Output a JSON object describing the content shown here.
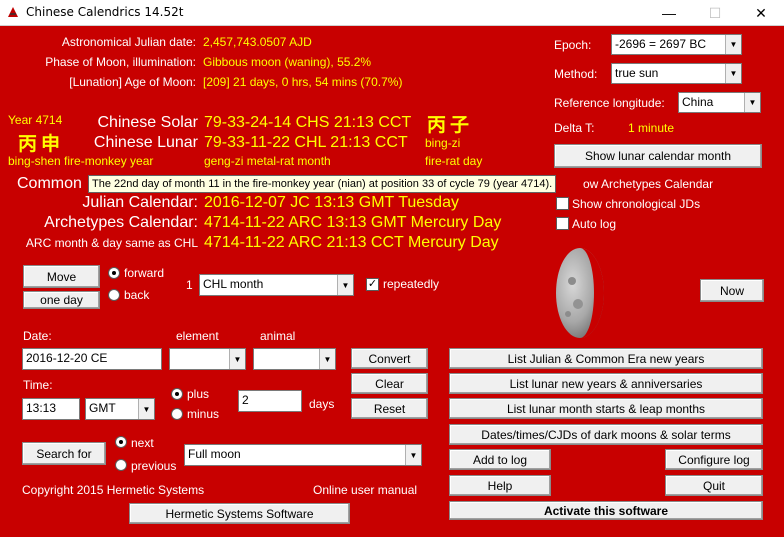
{
  "window": {
    "title": "Chinese Calendrics 14.52t",
    "minimize": "—",
    "maximize": "☐",
    "close": "✕"
  },
  "info": {
    "jd_label": "Astronomical Julian date:",
    "jd_value": "2,457,743.0507 AJD",
    "moon_label": "Phase of Moon, illumination:",
    "moon_value": "Gibbous moon (waning), 55.2%",
    "age_label": "[Lunation] Age of Moon:",
    "age_value": "[209] 21 days, 0 hrs, 54 mins (70.7%)"
  },
  "calendar": {
    "year_label": "Year 4714",
    "year_chars": "丙申",
    "year_pinyin": "bing-shen fire-monkey year",
    "solar_label": "Chinese Solar",
    "solar_value": "79-33-24-14 CHS 21:13 CCT",
    "lunar_label": "Chinese Lunar",
    "lunar_value": "79-33-11-22 CHL 21:13 CCT",
    "month_pinyin": "geng-zi metal-rat month",
    "day_chars": "丙子",
    "day_romanized": "bing-zi",
    "day_pinyin": "fire-rat day",
    "common_label": "Common",
    "julian_label": "Julian Calendar:",
    "julian_value": "2016-12-07 JC 13:13 GMT Tuesday",
    "arch_label": "Archetypes Calendar:",
    "arch_value": "4714-11-22 ARC 13:13 GMT Mercury Day",
    "arc_chl_label": "ARC month & day same as CHL",
    "arc_chl_value": "4714-11-22 ARC 21:13 CCT Mercury Day"
  },
  "tooltip": "The 22nd day of month 11 in the fire-monkey year (nian) at position 33 of cycle 79 (year 4714).",
  "right_panel": {
    "epoch_label": "Epoch:",
    "epoch_value": "-2696 = 2697 BC",
    "method_label": "Method:",
    "method_value": "true sun",
    "reflong_label": "Reference longitude:",
    "reflong_value": "China",
    "delta_label": "Delta T:",
    "delta_value": "1 minute",
    "show_lunar_button": "Show lunar calendar month",
    "archetypes_cal_partial": "ow Archetypes Calendar",
    "show_chrono": "Show chronological JDs",
    "auto_log": "Auto log",
    "now_button": "Now"
  },
  "move": {
    "move_button": "Move",
    "one_day_button": "one day",
    "forward": "forward",
    "back": "back",
    "count": "1",
    "unit_value": "CHL month",
    "repeatedly": "repeatedly"
  },
  "form": {
    "date_label": "Date:",
    "date_value": "2016-12-20 CE",
    "element_label": "element",
    "animal_label": "animal",
    "element_value": "",
    "animal_value": "",
    "time_label": "Time:",
    "time_value": "13:13",
    "tz_value": "GMT",
    "plus": "plus",
    "minus": "minus",
    "days_value": "2",
    "days_label": "days",
    "convert_button": "Convert",
    "clear_button": "Clear",
    "reset_button": "Reset",
    "search_button": "Search for",
    "next": "next",
    "previous": "previous",
    "search_value": "Full moon"
  },
  "lists": {
    "julian_common": "List Julian & Common Era new years",
    "lunar_new_years": "List lunar new years & anniversaries",
    "lunar_month_starts": "List lunar month starts & leap months",
    "dark_moons": "Dates/times/CJDs of dark moons & solar terms",
    "add_to_log": "Add to log",
    "configure_log": "Configure log",
    "help": "Help",
    "quit": "Quit",
    "activate": "Activate this software"
  },
  "footer": {
    "copyright": "Copyright 2015  Hermetic Systems",
    "manual": "Online user manual",
    "hs_software": "Hermetic Systems Software"
  },
  "colors": {
    "background": "#c80000",
    "label": "#ffffff",
    "value": "#ffff00"
  },
  "moon": {
    "illumination_percent": 55.2,
    "phase": "waning gibbous"
  }
}
